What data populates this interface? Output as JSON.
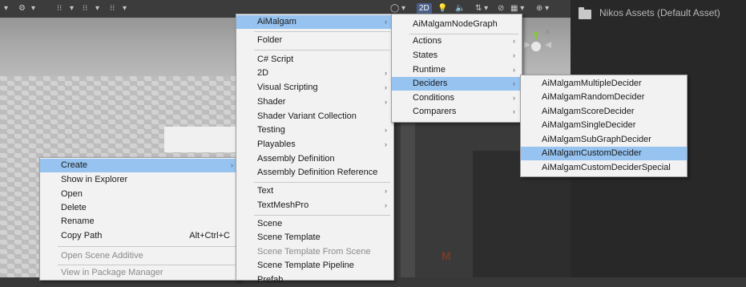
{
  "scene_toolbar": {
    "items": [
      "▾",
      "⚙",
      "▾",
      "⁝⁝",
      "▾",
      "⁝⁝",
      "▾",
      "⁝⁝",
      "▾"
    ],
    "right_items": [
      "◯ ▾",
      "2D",
      "💡",
      "🔈",
      "⇅ ▾",
      "⊘",
      "▦ ▾",
      "⊕ ▾"
    ]
  },
  "project": {
    "asset_label": "Nikos Assets (Default Asset)"
  },
  "scene": {
    "logo_glyph": "M"
  },
  "menu1": {
    "items": [
      {
        "label": "Create",
        "highlighted": true,
        "arrow": "›"
      },
      {
        "label": "Show in Explorer"
      },
      {
        "label": "Open"
      },
      {
        "label": "Delete"
      },
      {
        "label": "Rename"
      },
      {
        "label": "Copy Path",
        "shortcut": "Alt+Ctrl+C"
      },
      {
        "label": "Open Scene Additive",
        "disabled": true
      },
      {
        "label": "View in Package Manager",
        "disabled": true
      }
    ]
  },
  "menu2": {
    "items": [
      {
        "label": "AiMalgam",
        "highlighted": true,
        "arrow": "›"
      },
      {
        "label": "Folder"
      },
      {
        "label": "C# Script"
      },
      {
        "label": "2D",
        "arrow": "›"
      },
      {
        "label": "Visual Scripting",
        "arrow": "›"
      },
      {
        "label": "Shader",
        "arrow": "›"
      },
      {
        "label": "Shader Variant Collection"
      },
      {
        "label": "Testing",
        "arrow": "›"
      },
      {
        "label": "Playables",
        "arrow": "›"
      },
      {
        "label": "Assembly Definition"
      },
      {
        "label": "Assembly Definition Reference"
      },
      {
        "label": "Text",
        "arrow": "›"
      },
      {
        "label": "TextMeshPro",
        "arrow": "›"
      },
      {
        "label": "Scene"
      },
      {
        "label": "Scene Template"
      },
      {
        "label": "Scene Template From Scene",
        "disabled": true
      },
      {
        "label": "Scene Template Pipeline"
      },
      {
        "label": "Prefab"
      }
    ]
  },
  "menu3": {
    "items": [
      {
        "label": "AiMalgamNodeGraph"
      },
      {
        "label": "Actions",
        "arrow": "›"
      },
      {
        "label": "States",
        "arrow": "›"
      },
      {
        "label": "Runtime",
        "arrow": "›"
      },
      {
        "label": "Deciders",
        "highlighted": true,
        "arrow": "›"
      },
      {
        "label": "Conditions",
        "arrow": "›"
      },
      {
        "label": "Comparers",
        "arrow": "›"
      }
    ]
  },
  "menu4": {
    "items": [
      {
        "label": "AiMalgamMultipleDecider"
      },
      {
        "label": "AiMalgamRandomDecider"
      },
      {
        "label": "AiMalgamScoreDecider"
      },
      {
        "label": "AiMalgamSingleDecider"
      },
      {
        "label": "AiMalgamSubGraphDecider"
      },
      {
        "label": "AiMalgamCustomDecider",
        "highlighted": true
      },
      {
        "label": "AiMalgamCustomDeciderSpecial"
      }
    ]
  },
  "colors": {
    "highlight": "#96c3f0",
    "menu_bg": "#f2f2f2",
    "panel_bg": "#282828"
  }
}
